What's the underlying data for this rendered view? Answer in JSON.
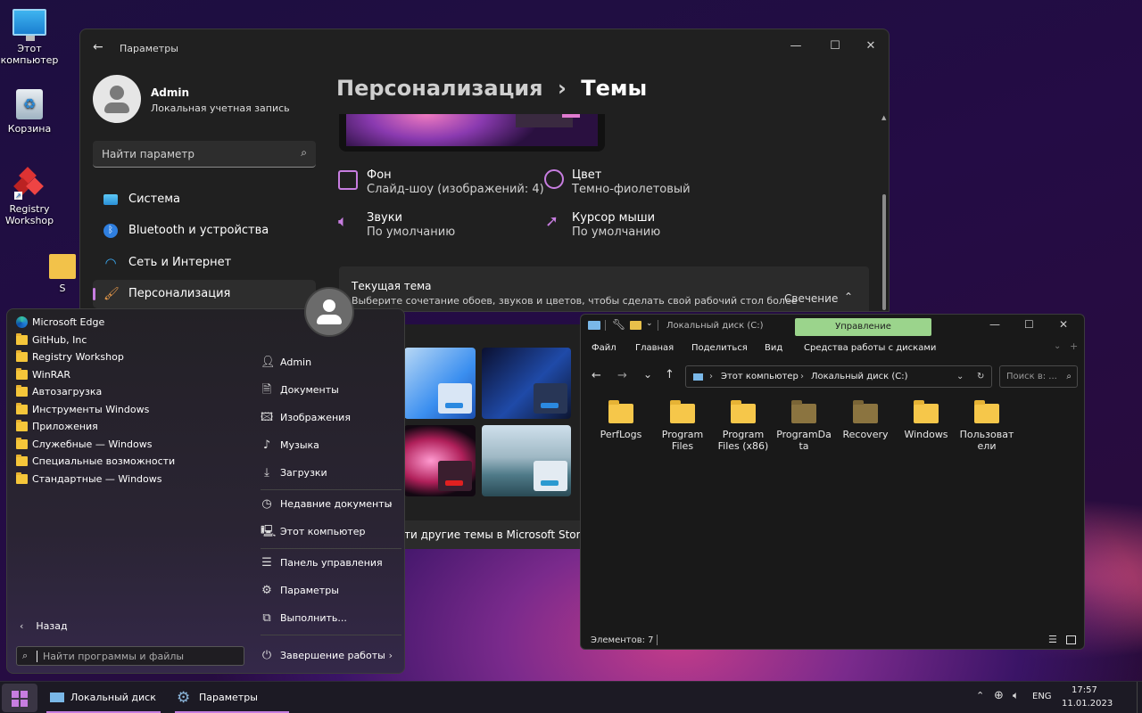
{
  "desktop": {
    "icons": [
      {
        "label": "Этот компьютер"
      },
      {
        "label": "Корзина"
      },
      {
        "label": "Registry Workshop"
      },
      {
        "label": "S"
      }
    ]
  },
  "settings": {
    "title": "Параметры",
    "user": {
      "name": "Admin",
      "account": "Локальная учетная запись"
    },
    "search_placeholder": "Найти параметр",
    "nav": [
      {
        "label": "Система"
      },
      {
        "label": "Bluetooth и устройства"
      },
      {
        "label": "Сеть и Интернет"
      },
      {
        "label": "Персонализация"
      }
    ],
    "breadcrumb_parent": "Персонализация",
    "breadcrumb_sep": "›",
    "page_title": "Темы",
    "props": [
      {
        "title": "Фон",
        "value": "Слайд-шоу (изображений: 4)"
      },
      {
        "title": "Цвет",
        "value": "Темно-фиолетовый"
      },
      {
        "title": "Звуки",
        "value": "По умолчанию"
      },
      {
        "title": "Курсор мыши",
        "value": "По умолчанию"
      }
    ],
    "current_theme": {
      "title": "Текущая тема",
      "desc": "Выберите сочетание обоев, звуков и цветов, чтобы сделать свой рабочий стол более",
      "value": "Свечение"
    },
    "store_link": "ти другие темы в Microsoft Store"
  },
  "start_menu": {
    "apps": [
      {
        "label": "Microsoft Edge"
      },
      {
        "label": "GitHub, Inc"
      },
      {
        "label": "Registry Workshop"
      },
      {
        "label": "WinRAR"
      },
      {
        "label": "Автозагрузка"
      },
      {
        "label": "Инструменты Windows"
      },
      {
        "label": "Приложения"
      },
      {
        "label": "Служебные — Windows"
      },
      {
        "label": "Специальные возможности"
      },
      {
        "label": "Стандартные — Windows"
      }
    ],
    "back_label": "Назад",
    "search_placeholder": "Найти программы и файлы",
    "right": [
      {
        "label": "Admin"
      },
      {
        "label": "Документы"
      },
      {
        "label": "Изображения"
      },
      {
        "label": "Музыка"
      },
      {
        "label": "Загрузки"
      },
      {
        "label": "Недавние документы"
      },
      {
        "label": "Этот компьютер"
      },
      {
        "label": "Панель управления"
      },
      {
        "label": "Параметры"
      },
      {
        "label": "Выполнить..."
      }
    ],
    "shutdown_label": "Завершение работы"
  },
  "explorer": {
    "title": "Локальный диск (C:)",
    "manage_tab": "Управление",
    "ribbon_tabs": [
      "Файл",
      "Главная",
      "Поделиться",
      "Вид",
      "Средства работы с дисками"
    ],
    "address": [
      "Этот компьютер",
      "Локальный диск (C:)"
    ],
    "search_placeholder": "Поиск в: ...",
    "folders": [
      {
        "name": "PerfLogs",
        "dim": false
      },
      {
        "name": "Program Files",
        "dim": false
      },
      {
        "name": "Program Files (x86)",
        "dim": false
      },
      {
        "name": "ProgramData",
        "dim": true
      },
      {
        "name": "Recovery",
        "dim": true
      },
      {
        "name": "Windows",
        "dim": false
      },
      {
        "name": "Пользователи",
        "dim": false
      }
    ],
    "status": "Элементов: 7"
  },
  "taskbar": {
    "apps": [
      {
        "label": "Локальный диск (..."
      },
      {
        "label": "Параметры"
      }
    ],
    "lang": "ENG",
    "time": "17:57",
    "date": "11.01.2023"
  },
  "colors": {
    "accent": "#c77de0",
    "folder": "#f6c74a",
    "manage_tab": "#9bd48c"
  }
}
